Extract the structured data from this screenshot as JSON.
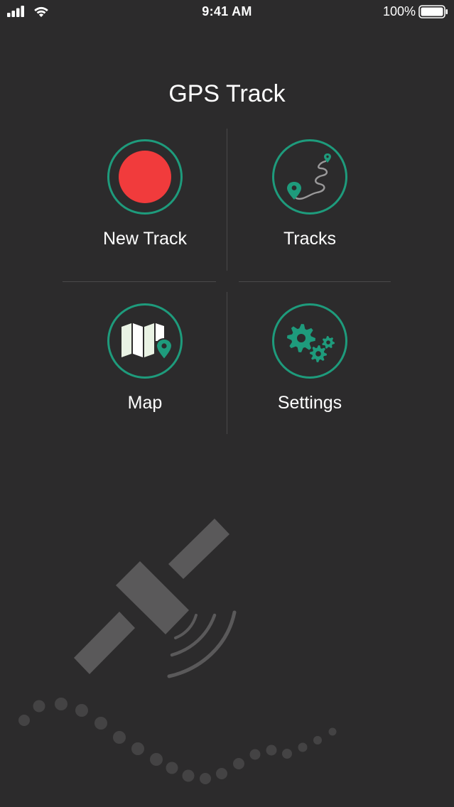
{
  "status_bar": {
    "time": "9:41 AM",
    "battery_percent": "100%",
    "battery_level": 1.0
  },
  "app": {
    "title": "GPS Track"
  },
  "menu": {
    "new_track": {
      "label": "New Track",
      "icon": "record-icon"
    },
    "tracks": {
      "label": "Tracks",
      "icon": "route-icon"
    },
    "map": {
      "label": "Map",
      "icon": "map-icon"
    },
    "settings": {
      "label": "Settings",
      "icon": "gears-icon"
    }
  },
  "colors": {
    "background": "#2c2b2c",
    "accent": "#1e9b7c",
    "record": "#f13b3c",
    "divider": "#4a494a",
    "decor": "#5a595a"
  }
}
